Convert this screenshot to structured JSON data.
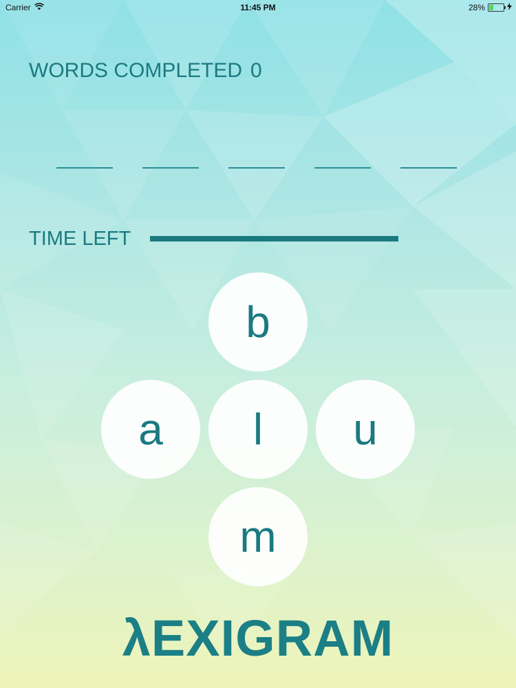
{
  "status_bar": {
    "carrier": "Carrier",
    "time": "11:45 PM",
    "battery": "28%",
    "battery_level": 0.28
  },
  "game": {
    "words_completed_label": "WORDS COMPLETED",
    "words_completed_value": "0",
    "blank_count": 5,
    "time_left_label": "TIME LEFT",
    "time_left_fraction": 1.0,
    "tiles": {
      "top": "b",
      "left": "a",
      "center": "l",
      "right": "u",
      "bottom": "m"
    }
  },
  "logo": {
    "text": "λEXIGRAM"
  },
  "colors": {
    "accent": "#1b7a80",
    "tile_background": "#ffffff"
  },
  "icons": [
    "wifi-icon",
    "battery-icon",
    "charging-icon"
  ]
}
